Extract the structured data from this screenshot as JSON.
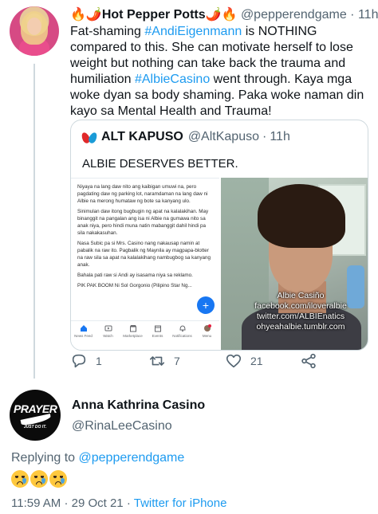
{
  "parent_tweet": {
    "name": "🔥🌶️Hot Pepper Potts🌶️🔥",
    "handle": "@pepperendgame",
    "separator": "·",
    "time": "11h",
    "text_a": "Fat-shaming ",
    "mention": "#AndiEigenmann",
    "text_b": " is NOTHING compared to this. She can motivate herself to lose weight but nothing can take back the trauma and humiliation ",
    "hashtag": "#AlbieCasino",
    "text_c": " went through. Kaya mga woke dyan sa body shaming. Paka woke naman din kayo sa Mental Health and Trauma!",
    "actions": {
      "reply_count": "1",
      "retweet_count": "7",
      "like_count": "21"
    }
  },
  "quoted_tweet": {
    "name": "ALT KAPUSO",
    "handle": "@AltKapuso",
    "separator": "·",
    "time": "11h",
    "text": "ALBIE DESERVES BETTER.",
    "screenshot_paragraphs": [
      "Niyaya na lang daw nito ang kaibigan umuwi na, pero pagdating daw ng parking lot, naramdaman na lang daw ni Albie na merong humataw ng bote sa kanyang ulo.",
      "Sinimulan daw itong bugbugin ng apat na kalalakihan. May binanggit na pangalan ang isa ni Albie na gumawa nito sa anak niya, pero hindi muna natin mabanggit dahil hindi pa sila nakakasuhan.",
      "Nasa Subic pa si Mrs. Casino nang nakausap namin at pabalik na raw ito. Pagbalik ng Maynila ay magpapa-blotter na raw sila sa apat na kalalakihang nambugbog sa kanyang anak.",
      "Bahala pati raw si Andi ay isasama niya sa reklamo.",
      "PIK PAK BOOM Ni Sol Gorgonio (Pilipino Star Ng..."
    ],
    "screenshot_nav": [
      "News Feed",
      "Watch",
      "Marketplace",
      "Events",
      "Notifications",
      "Menu"
    ],
    "photo_caption": [
      "Albie Casiño",
      "facebook.com/iloveralbie",
      "twitter.com/ALBIEnatics",
      "ohyeahalbie.tumblr.com"
    ]
  },
  "reply_tweet": {
    "avatar_text": "PRAYER",
    "avatar_subtext": "JUST DO IT.",
    "name": "Anna Kathrina Casino",
    "handle": "@RinaLeeCasino",
    "replying_prefix": "Replying to ",
    "replying_to": "@pepperendgame",
    "emoji_text": "😢😢😢",
    "time": "11:59 AM",
    "separator": "·",
    "date": "29 Oct 21",
    "source_separator": "·",
    "source": "Twitter for iPhone"
  },
  "colors": {
    "link": "#1d9bf0",
    "muted": "#536471",
    "text": "#0f1419"
  }
}
